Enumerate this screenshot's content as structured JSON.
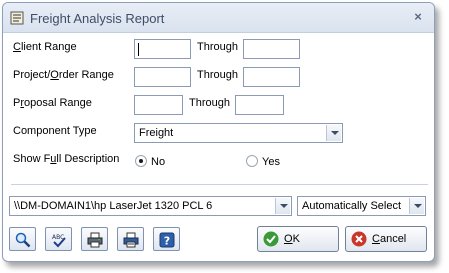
{
  "window": {
    "title": "Freight Analysis Report"
  },
  "form": {
    "client_range": {
      "label_pre": "",
      "label_ul": "C",
      "label_post": "lient Range",
      "from_value": "",
      "through_label": "Through",
      "to_value": ""
    },
    "project_range": {
      "label_pre": "Project/",
      "label_ul": "O",
      "label_post": "rder Range",
      "from_value": "",
      "through_label": "Through",
      "to_value": ""
    },
    "proposal_range": {
      "label_pre": "P",
      "label_ul": "r",
      "label_post": "oposal Range",
      "from_value": "",
      "through_label": "Through",
      "to_value": ""
    },
    "component_type": {
      "label": "Component Type",
      "selected": "Freight"
    },
    "show_full_description": {
      "label_pre": "Show F",
      "label_ul": "u",
      "label_post": "ll Description",
      "options": [
        {
          "label": "No",
          "selected": true
        },
        {
          "label": "Yes",
          "selected": false
        }
      ]
    }
  },
  "printer": {
    "selected": "\\\\DM-DOMAIN1\\hp LaserJet 1320 PCL 6",
    "tray": "Automatically Select"
  },
  "toolbar": {
    "icons": [
      "preview-icon",
      "spell-check-icon",
      "print-icon",
      "print-setup-icon",
      "help-icon"
    ]
  },
  "buttons": {
    "ok": {
      "label_ul": "O",
      "label_post": "K",
      "color": "#2e8b2e"
    },
    "cancel": {
      "label_ul": "C",
      "label_post": "ancel",
      "color": "#c0392b"
    }
  }
}
